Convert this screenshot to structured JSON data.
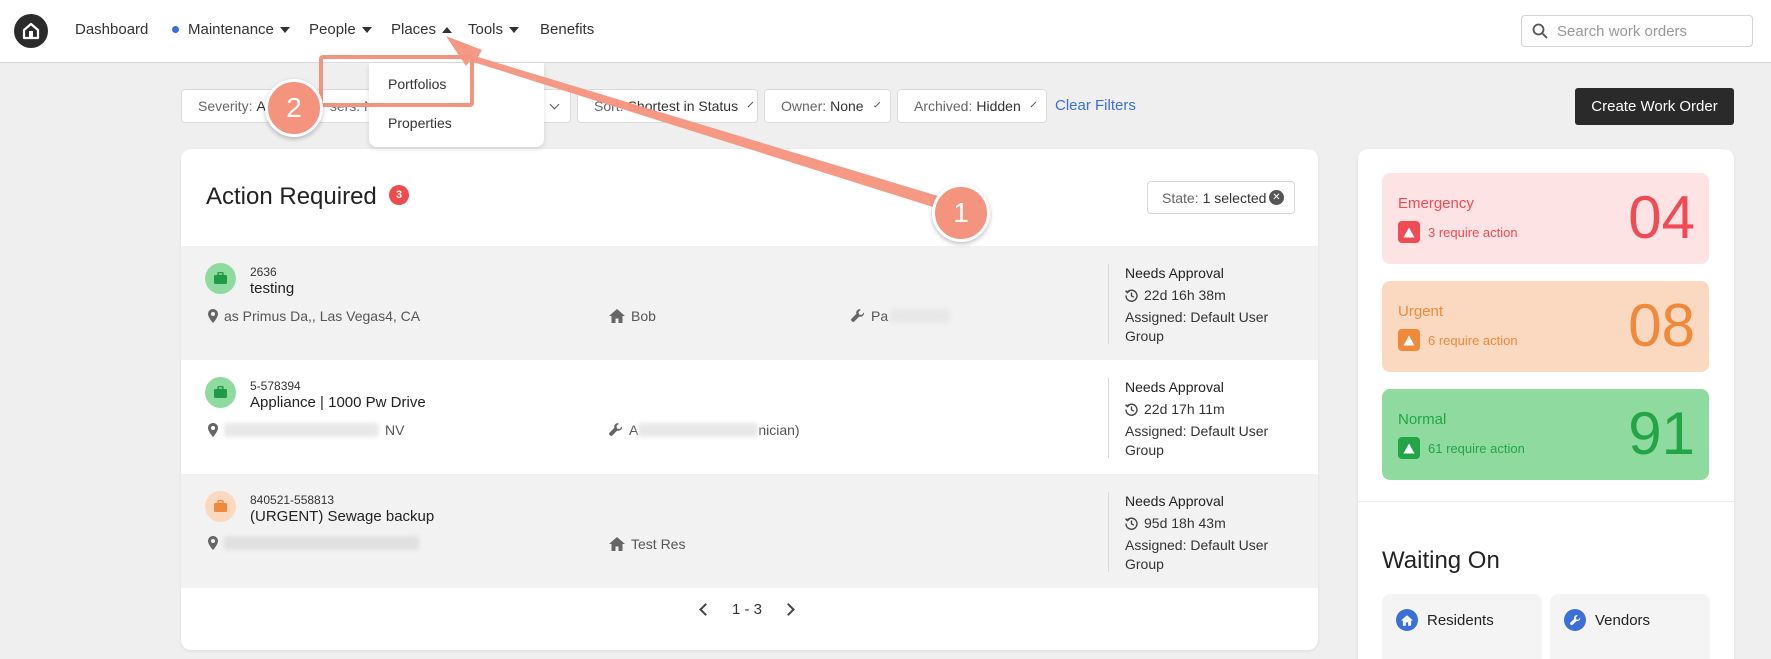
{
  "nav": {
    "items": [
      {
        "label": "Dashboard",
        "caret": "none"
      },
      {
        "label": "Maintenance",
        "caret": "down",
        "dot": true
      },
      {
        "label": "People",
        "caret": "down"
      },
      {
        "label": "Places",
        "caret": "up"
      },
      {
        "label": "Tools",
        "caret": "down"
      },
      {
        "label": "Benefits",
        "caret": "none"
      }
    ],
    "search_placeholder": "Search work orders",
    "logo_icon": "home-icon"
  },
  "places_dropdown": {
    "items": [
      "Portfolios",
      "Properties"
    ]
  },
  "filters": {
    "severity_label": "Severity:",
    "severity_value": "A",
    "users_text": "sers: N",
    "sort_label": "Sort:",
    "sort_value": "Shortest in Status",
    "owner_label": "Owner:",
    "owner_value": "None",
    "archived_label": "Archived:",
    "archived_value": "Hidden",
    "clear_label": "Clear Filters"
  },
  "create_button": "Create Work Order",
  "action_required": {
    "title": "Action Required",
    "count": "3",
    "state_label": "State:",
    "state_value": "1 selected",
    "rows": [
      {
        "id": "2636",
        "title": "testing",
        "icon_color": "green",
        "location": "as Primus Da,, Las Vegas4, CA",
        "resident": "Bob",
        "vendor": "Pa",
        "status": "Needs Approval",
        "time": "22d 16h 38m",
        "assigned": "Assigned: Default User Group"
      },
      {
        "id": "5-578394",
        "title": "Appliance | 1000 Pw Drive",
        "icon_color": "green",
        "location": "NV",
        "vendor_prefix": "A",
        "vendor": "nician)",
        "status": "Needs Approval",
        "time": "22d 17h 11m",
        "assigned": "Assigned: Default User Group"
      },
      {
        "id": "840521-558813",
        "title": "(URGENT) Sewage backup",
        "icon_color": "orange",
        "resident": "Test Res",
        "status": "Needs Approval",
        "time": "95d 18h 43m",
        "assigned": "Assigned: Default User Group"
      }
    ],
    "pagination": "1 - 3"
  },
  "severity_cards": [
    {
      "label": "Emergency",
      "sub": "3 require action",
      "number": "04",
      "bg": "#fde3e3",
      "color": "#ef4b55"
    },
    {
      "label": "Urgent",
      "sub": "6 require action",
      "number": "08",
      "bg": "#fbd9c0",
      "color": "#f0893a"
    },
    {
      "label": "Normal",
      "sub": "61 require action",
      "number": "91",
      "bg": "#8fdb9f",
      "color": "#23a447"
    }
  ],
  "waiting_on": {
    "title": "Waiting On",
    "items": [
      {
        "label": "Residents",
        "icon": "home-icon"
      },
      {
        "label": "Vendors",
        "icon": "wrench-icon"
      }
    ]
  },
  "annotations": {
    "step1": "1",
    "step2": "2",
    "color": "#f4937e"
  }
}
